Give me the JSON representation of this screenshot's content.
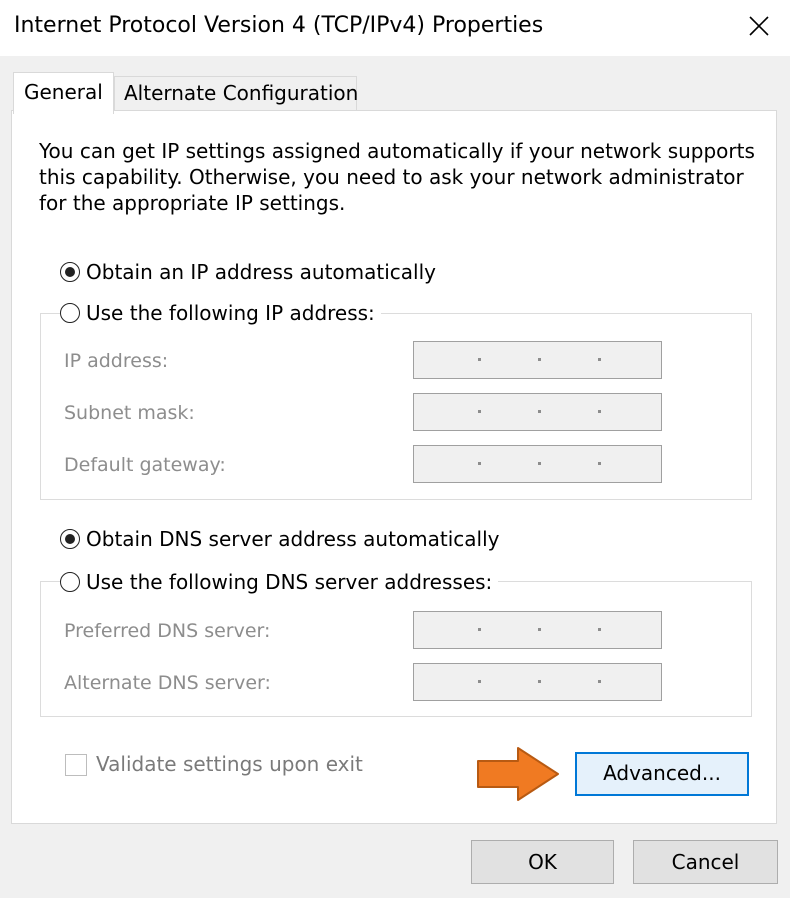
{
  "window": {
    "title": "Internet Protocol Version 4 (TCP/IPv4) Properties",
    "close_icon": "close-icon"
  },
  "tabs": [
    {
      "label": "General",
      "active": true
    },
    {
      "label": "Alternate Configuration",
      "active": false
    }
  ],
  "general": {
    "intro_text": "You can get IP settings assigned automatically if your network supports this capability. Otherwise, you need to ask your network administrator for the appropriate IP settings.",
    "ip_mode": {
      "auto_label": "Obtain an IP address automatically",
      "manual_label": "Use the following IP address:",
      "selected": "auto"
    },
    "ip_fields": [
      {
        "label": "IP address:",
        "value": ""
      },
      {
        "label": "Subnet mask:",
        "value": ""
      },
      {
        "label": "Default gateway:",
        "value": ""
      }
    ],
    "dns_mode": {
      "auto_label": "Obtain DNS server address automatically",
      "manual_label": "Use the following DNS server addresses:",
      "selected": "auto"
    },
    "dns_fields": [
      {
        "label": "Preferred DNS server:",
        "value": ""
      },
      {
        "label": "Alternate DNS server:",
        "value": ""
      }
    ],
    "validate_label": "Validate settings upon exit",
    "validate_checked": false,
    "advanced_label": "Advanced..."
  },
  "footer": {
    "ok_label": "OK",
    "cancel_label": "Cancel"
  },
  "colors": {
    "accent": "#0078d7",
    "arrow": "#f07a22",
    "dialog_bg": "#f0f0f0",
    "disabled_text": "#8d8d8d"
  }
}
